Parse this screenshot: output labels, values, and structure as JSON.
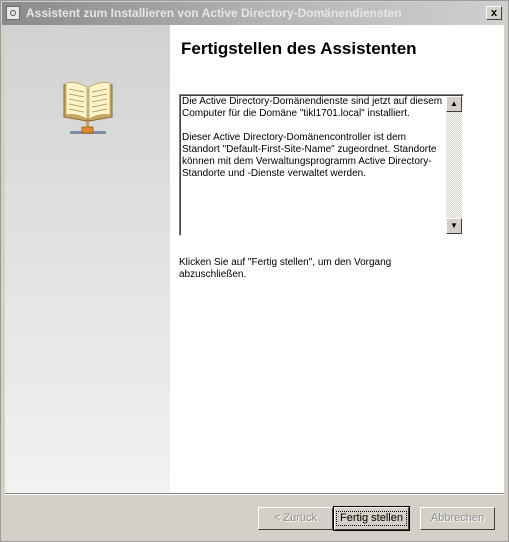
{
  "window": {
    "title": "Assistent zum Installieren von Active Directory-Domänendiensten",
    "close_label": "x"
  },
  "wizard": {
    "heading": "Fertigstellen des Assistenten",
    "summary_paragraphs": [
      "Die Active Directory-Domänendienste sind jetzt auf diesem Computer für die Domäne \"tikl1701.local\" installiert.",
      "Dieser Active Directory-Domänencontroller ist dem Standort \"Default-First-Site-Name\" zugeordnet. Standorte können mit dem Verwaltungsprogramm Active Directory-Standorte und -Dienste verwaltet werden."
    ],
    "instruction": "Klicken Sie auf \"Fertig stellen\", um den Vorgang abzuschließen.",
    "icon": "book-icon"
  },
  "buttons": {
    "back_label": "< Zurück",
    "finish_label": "Fertig stellen",
    "cancel_label": "Abbrechen"
  }
}
